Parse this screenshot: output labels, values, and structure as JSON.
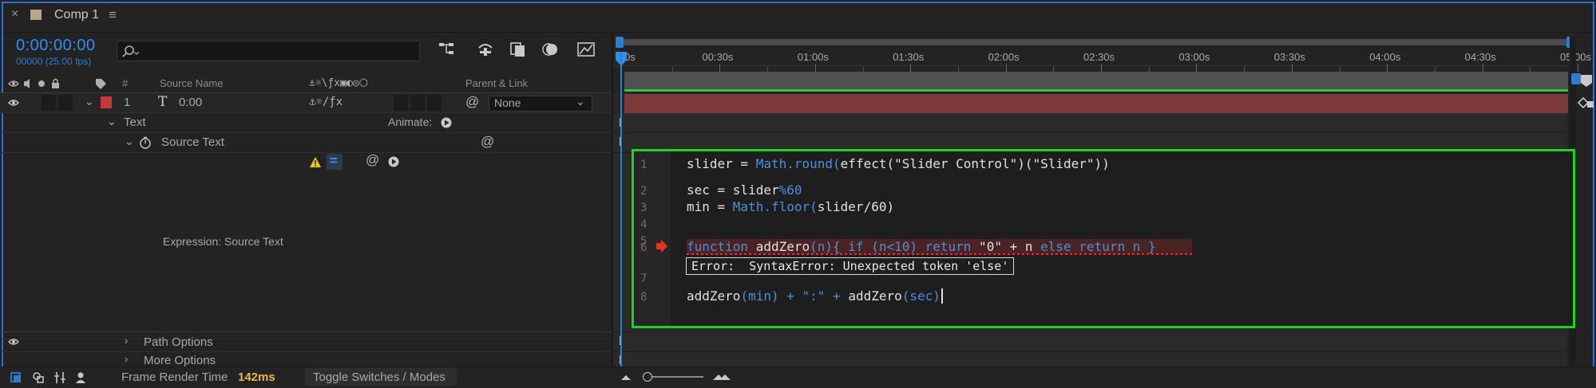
{
  "tab": {
    "close": "×",
    "title": "Comp 1",
    "menu": "≡"
  },
  "header": {
    "timecode": "0:00:00:00",
    "fps": "00000 (25.00 fps)"
  },
  "columns": {
    "number": "#",
    "source_name": "Source Name",
    "parent_link": "Parent & Link"
  },
  "layer": {
    "number": "1",
    "type_glyph": "T",
    "name": "0:00",
    "parent": "None",
    "label_color": "#c83a3a"
  },
  "groups": {
    "text": "Text",
    "animate": "Animate:",
    "source_text": "Source Text",
    "expression_label": "Expression: Source Text",
    "path_options": "Path Options",
    "more_options": "More Options"
  },
  "ruler": {
    "start": "0s",
    "ticks": [
      "00:30s",
      "01:00s",
      "01:30s",
      "02:00s",
      "02:30s",
      "03:00s",
      "03:30s",
      "04:00s",
      "04:30s",
      "05:00s"
    ]
  },
  "code": {
    "line_numbers": [
      "1",
      "2",
      "3",
      "4",
      "5",
      "6",
      "7",
      "8"
    ],
    "l1_a": "slider = ",
    "l1_b": "Math.round(",
    "l1_c": "effect(\"Slider Control\")(\"Slider\"))",
    "l3_a": "sec = slider",
    "l3_b": "%60",
    "l4_a": "min = ",
    "l4_b": "Math.floor(",
    "l4_c": "slider/60)",
    "l6_a": "function",
    "l6_b": " addZero",
    "l6_c": "(n){ ",
    "l6_d": "if",
    "l6_e": " (n<10) ",
    "l6_f": "return",
    "l6_g": " \"0\" + n ",
    "l6_h": "else",
    "l6_i": " ",
    "l6_j": "return",
    "l6_k": " n }",
    "error": "Error:  SyntaxError: Unexpected token 'else'",
    "l8_a": "addZero",
    "l8_b": "(min)",
    "l8_c": " + \":\" + ",
    "l8_d": "addZero",
    "l8_e": "(sec)"
  },
  "status": {
    "frame_render_label": "Frame Render Time",
    "frame_render_value": "142ms",
    "toggle": "Toggle Switches / Modes"
  },
  "colors": {
    "accent": "#2f8ef0",
    "editor_border": "#1ed21e",
    "layer_bar": "#7d3a3a",
    "warning": "#f2c811",
    "error_marker": "#e0391c"
  }
}
